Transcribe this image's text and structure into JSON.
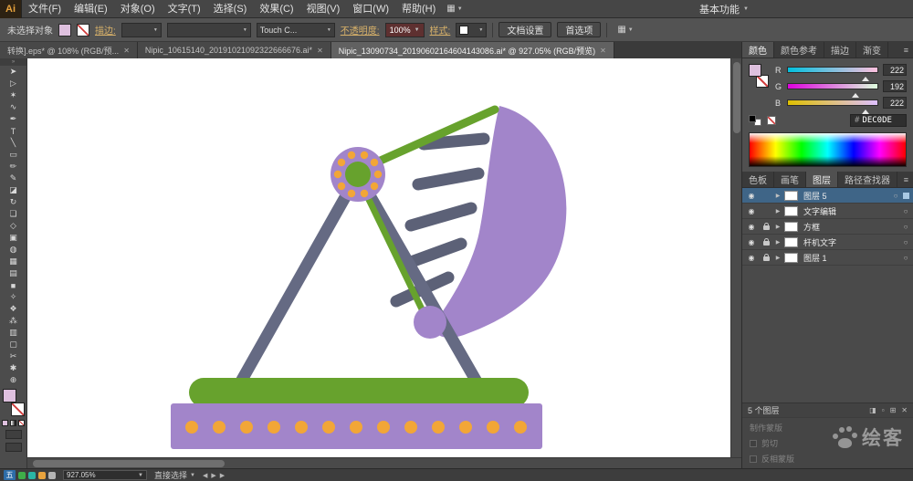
{
  "colors": {
    "fill_swatch": "#DEC0DE",
    "artwork_purple": "#A285CA",
    "artwork_green": "#67A22D",
    "artwork_slate": "#5C6177",
    "artwork_leg": "#656A83",
    "artwork_orange": "#F2A637",
    "selection_blue": "#3F6587"
  },
  "ui": {
    "close_glyph": "✕",
    "chevron_down": "▼",
    "panel_menu": "≡",
    "eye": "◉",
    "expand": "▶",
    "target": "○",
    "double_arrow": "»",
    "arrange_icon": "▦",
    "nav_left": "◀",
    "nav_right": "▶"
  },
  "menu_bar": {
    "logo": "Ai",
    "items": [
      "文件(F)",
      "编辑(E)",
      "对象(O)",
      "文字(T)",
      "选择(S)",
      "效果(C)",
      "视图(V)",
      "窗口(W)",
      "帮助(H)"
    ],
    "workspace": "基本功能"
  },
  "control_bar": {
    "selection_status": "未选择对象",
    "stroke_label": "描边:",
    "brush_value": "Touch C...",
    "opacity_label": "不透明度:",
    "opacity_value": "100%",
    "style_label": "样式:",
    "doc_setup_button": "文档设置",
    "preferences_button": "首选项"
  },
  "document_tabs": [
    {
      "label": "转换].eps* @ 108% (RGB/预...",
      "active": false
    },
    {
      "label": "Nipic_10615140_20191021092322666676.ai*",
      "active": false
    },
    {
      "label": "Nipic_13090734_20190602164604143086.ai* @ 927.05% (RGB/预览)",
      "active": true
    }
  ],
  "tools": [
    {
      "name": "selection-tool",
      "glyph": "➤"
    },
    {
      "name": "direct-selection-tool",
      "glyph": "▷"
    },
    {
      "name": "magic-wand-tool",
      "glyph": "✶"
    },
    {
      "name": "lasso-tool",
      "glyph": "∿"
    },
    {
      "name": "pen-tool",
      "glyph": "✒"
    },
    {
      "name": "type-tool",
      "glyph": "T"
    },
    {
      "name": "line-segment-tool",
      "glyph": "╲"
    },
    {
      "name": "rectangle-tool",
      "glyph": "▭"
    },
    {
      "name": "paintbrush-tool",
      "glyph": "✏"
    },
    {
      "name": "pencil-tool",
      "glyph": "✎"
    },
    {
      "name": "eraser-tool",
      "glyph": "◪"
    },
    {
      "name": "rotate-tool",
      "glyph": "↻"
    },
    {
      "name": "scale-tool",
      "glyph": "❏"
    },
    {
      "name": "width-tool",
      "glyph": "◇"
    },
    {
      "name": "free-transform-tool",
      "glyph": "▣"
    },
    {
      "name": "shape-builder-tool",
      "glyph": "◍"
    },
    {
      "name": "perspective-grid-tool",
      "glyph": "▦"
    },
    {
      "name": "mesh-tool",
      "glyph": "▤"
    },
    {
      "name": "gradient-tool",
      "glyph": "■"
    },
    {
      "name": "eyedropper-tool",
      "glyph": "✧"
    },
    {
      "name": "blend-tool",
      "glyph": "❖"
    },
    {
      "name": "symbol-sprayer-tool",
      "glyph": "⁂"
    },
    {
      "name": "column-graph-tool",
      "glyph": "▥"
    },
    {
      "name": "artboard-tool",
      "glyph": "▢"
    },
    {
      "name": "slice-tool",
      "glyph": "✂"
    },
    {
      "name": "hand-tool",
      "glyph": "✱"
    },
    {
      "name": "zoom-tool",
      "glyph": "⊕"
    }
  ],
  "color_panel": {
    "tabs": [
      "颜色",
      "颜色参考",
      "描边",
      "渐变"
    ],
    "channels": [
      {
        "label": "R",
        "value": "222"
      },
      {
        "label": "G",
        "value": "192"
      },
      {
        "label": "B",
        "value": "222"
      }
    ],
    "hex_hash": "#",
    "hex_value": "DEC0DE"
  },
  "panel_dock": {
    "tabs": [
      "色板",
      "画笔",
      "图层",
      "路径查找器"
    ],
    "active_tab": "图层"
  },
  "layers_panel": {
    "rows": [
      {
        "name": "图层 5",
        "visible": true,
        "locked": false,
        "selected": true
      },
      {
        "name": "文字编辑",
        "visible": true,
        "locked": false,
        "selected": false
      },
      {
        "name": "方框",
        "visible": true,
        "locked": true,
        "selected": false
      },
      {
        "name": "杆机文字",
        "visible": true,
        "locked": true,
        "selected": false
      },
      {
        "name": "图层 1",
        "visible": true,
        "locked": true,
        "selected": false
      }
    ],
    "status": "5 个图层",
    "buttons": [
      {
        "name": "make-clip-mask",
        "glyph": "◨"
      },
      {
        "name": "new-sublayer",
        "glyph": "▫"
      },
      {
        "name": "new-layer",
        "glyph": "⊞"
      },
      {
        "name": "delete-layer",
        "glyph": "✕"
      }
    ]
  },
  "transparency_panel": {
    "make_mask": "制作蒙版",
    "clip": "剪切",
    "invert_mask": "反相蒙版"
  },
  "status_bar": {
    "zoom_value": "927.05%",
    "tool_label": "直接选择"
  },
  "ime": {
    "badge": "五",
    "dots": [
      "#3fae49",
      "#2ab5a5",
      "#e8a33d",
      "#b5b5b5"
    ]
  },
  "watermark": {
    "text": "绘客"
  }
}
